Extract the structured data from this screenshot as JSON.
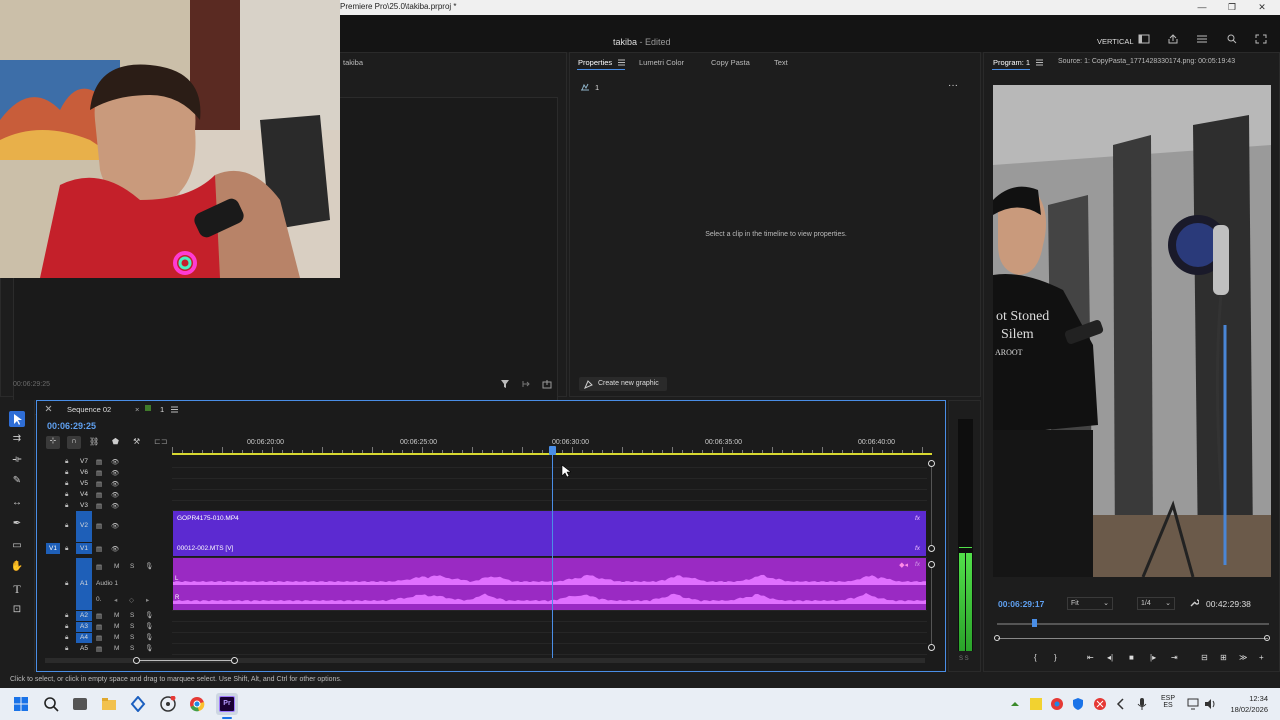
{
  "window": {
    "title": "Premiere Pro\\25.0\\takiba.prproj *",
    "minimize": "—",
    "restore": "❐",
    "close": "✕"
  },
  "header": {
    "project": "takiba",
    "status": "- Edited",
    "workspace": "VERTICAL"
  },
  "source_panel": {
    "tab": "takiba",
    "timecode": "00:06:29:25"
  },
  "properties_panel": {
    "tabs": [
      "Properties",
      "Lumetri Color",
      "Copy Pasta",
      "Text"
    ],
    "item_label": "1",
    "empty_message": "Select a clip in the timeline to view properties.",
    "create_graphic": "Create new graphic"
  },
  "program_monitor": {
    "tab": "Program: 1",
    "source_label": "Source: 1: CopyPasta_1771428330174.png: 00:05:19:43",
    "timecode": "00:06:29:17",
    "fit": "Fit",
    "resolution": "1/4",
    "duration": "00:42:29:38",
    "playhead_fraction": 0.13,
    "frame_text": {
      "shirt_line1": "ot Stoned",
      "shirt_line2": "Silem",
      "shirt_line3": "AROOT"
    }
  },
  "timeline": {
    "sequence_tab": "Sequence 02",
    "sequence_num": "1",
    "timecode": "00:06:29:25",
    "ruler_labels": [
      "00:06:20:00",
      "00:06:25:00",
      "00:06:30:00",
      "00:06:35:00",
      "00:06:40:00"
    ],
    "tracks_video": [
      "V7",
      "V6",
      "V5",
      "V4",
      "V3",
      "V2",
      "V1"
    ],
    "tracks_audio": [
      "A1",
      "A2",
      "A3",
      "A4",
      "A5"
    ],
    "source_patch_video": "V1",
    "audio_track_name": "Audio 1",
    "audio_volume": "0.",
    "track_mute": "M",
    "track_solo": "S",
    "channel_left": "L",
    "channel_right": "R",
    "clip_v2": "GOPR4175-010.MP4",
    "clip_v1": "00012-002.MTS [V]",
    "fx_badge": "fx"
  },
  "audio_meter": {
    "label": "S S"
  },
  "status_bar": {
    "text": "Click to select, or click in empty space and drag to marquee select. Use Shift, Alt, and Ctrl for other options."
  },
  "taskbar": {
    "lang_top": "ESP",
    "lang_bottom": "ES",
    "time": "12:34",
    "date": "18/02/2026"
  },
  "colors": {
    "accent": "#4a8ee6",
    "video_clip": "#5c2ad1",
    "audio_clip": "#9a2ac3",
    "waveform": "#e070ff"
  }
}
